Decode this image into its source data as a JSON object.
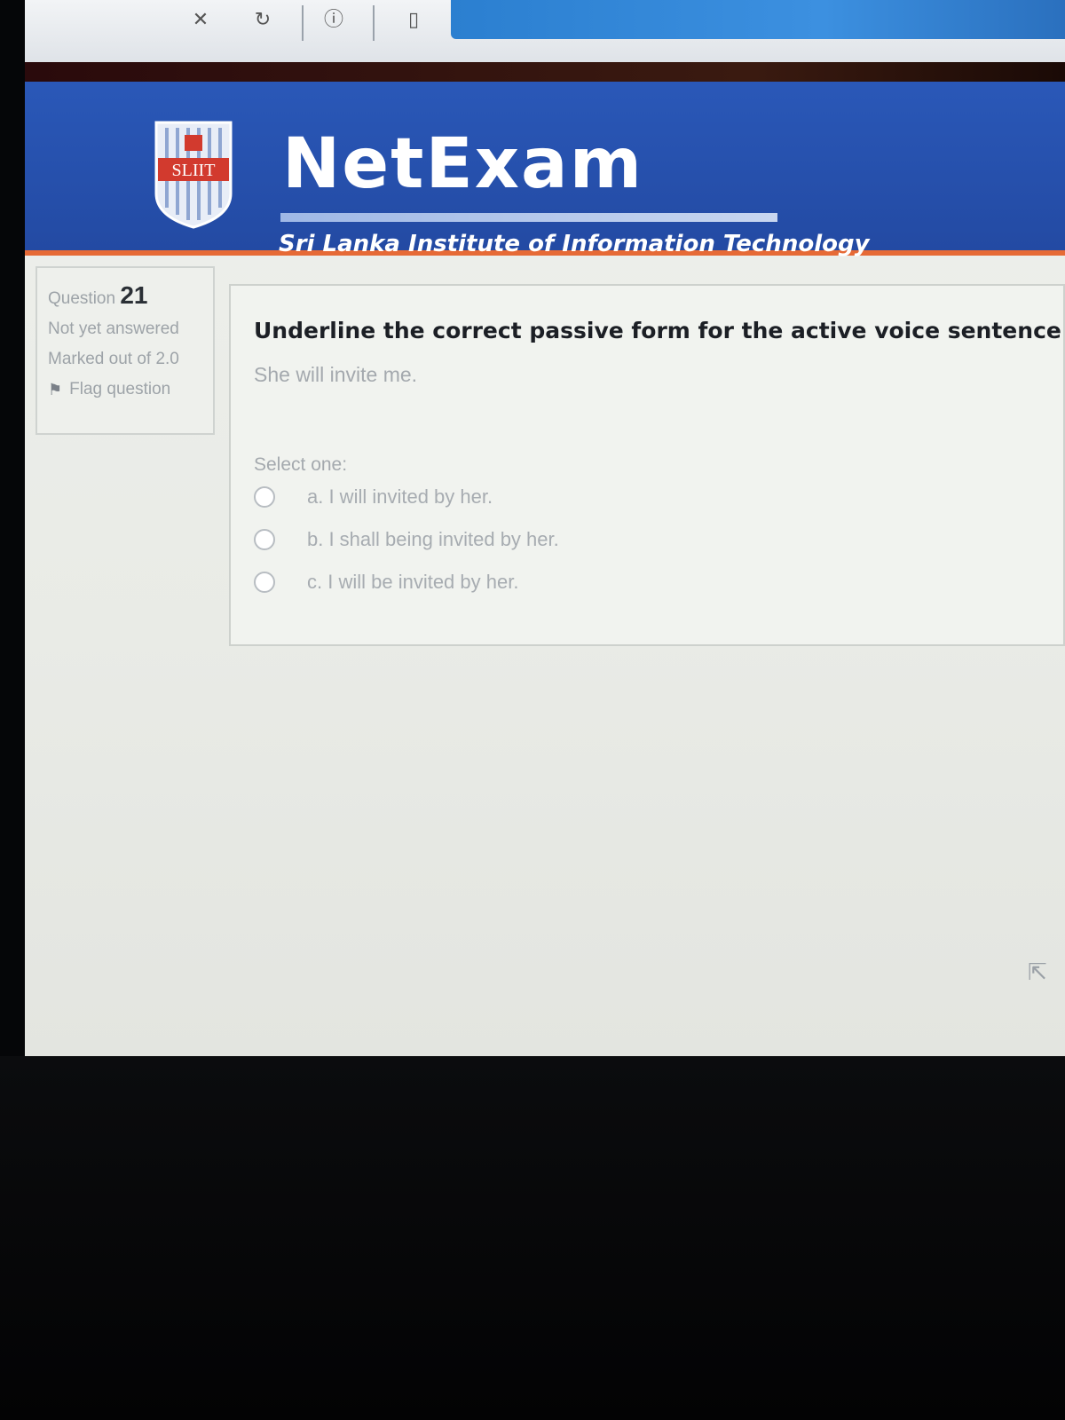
{
  "brand": {
    "logo_text": "SLIIT",
    "title": "NetExam",
    "subtitle": "Sri Lanka Institute of Information Technology"
  },
  "question_info": {
    "question_label": "Question",
    "question_number": "21",
    "status": "Not yet answered",
    "marks": "Marked out of 2.0",
    "flag_label": "Flag question"
  },
  "question": {
    "prompt": "Underline the correct passive form for the active voice sentence given belo",
    "sentence": "She will invite me.",
    "select_label": "Select one:",
    "options": [
      "a. I will invited by her.",
      "b. I shall being invited by her.",
      "c. I will be invited by her."
    ]
  },
  "colors": {
    "banner": "#2a58b8",
    "accent": "#e66a36"
  }
}
